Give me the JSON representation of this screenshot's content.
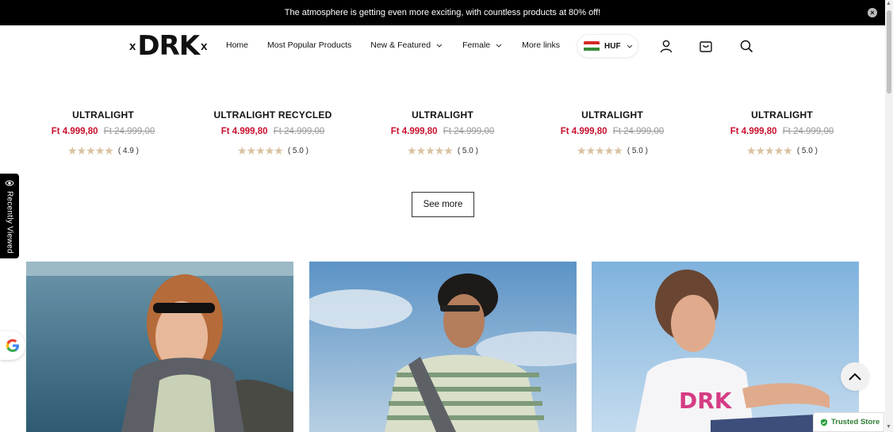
{
  "announcement": {
    "text": "The atmosphere is getting even more exciting, with countless products at 80% off!"
  },
  "logo": {
    "main": "DRK",
    "cross": "x"
  },
  "nav": {
    "items": [
      {
        "label": "Home"
      },
      {
        "label": "Most Popular Products"
      },
      {
        "label": "New & Featured"
      },
      {
        "label": "Female"
      },
      {
        "label": "More links"
      }
    ]
  },
  "currency": {
    "label": "HUF"
  },
  "products": [
    {
      "name": "ULTRALIGHT",
      "price": "Ft 4.999,80",
      "old_price": "Ft 24.999,00",
      "rating": "( 4.9 )",
      "stars": 5
    },
    {
      "name": "ULTRALIGHT RECYCLED",
      "price": "Ft 4.999,80",
      "old_price": "Ft 24.999,00",
      "rating": "( 5.0 )",
      "stars": 5
    },
    {
      "name": "ULTRALIGHT",
      "price": "Ft 4.999,80",
      "old_price": "Ft 24.999,00",
      "rating": "( 5.0 )",
      "stars": 5
    },
    {
      "name": "ULTRALIGHT",
      "price": "Ft 4.999,80",
      "old_price": "Ft 24.999,00",
      "rating": "( 5.0 )",
      "stars": 5
    },
    {
      "name": "ULTRALIGHT",
      "price": "Ft 4.999,80",
      "old_price": "Ft 24.999,00",
      "rating": "( 5.0 )",
      "stars": 5
    }
  ],
  "see_more": {
    "label": "See more"
  },
  "recently_viewed": {
    "label": "Recently Viewed"
  },
  "trusted_store": {
    "label": "Trusted Store"
  },
  "colors": {
    "price": "#c8102e",
    "star": "#d9c1a0",
    "announce_bg": "#000000"
  }
}
